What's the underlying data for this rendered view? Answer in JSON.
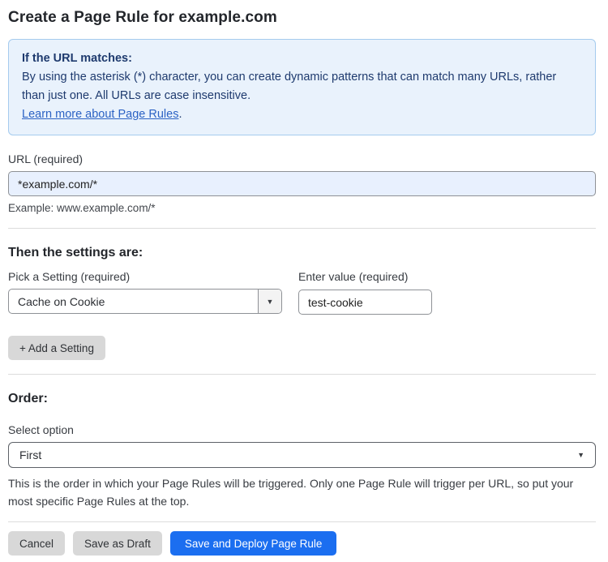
{
  "page": {
    "title": "Create a Page Rule for example.com"
  },
  "info_box": {
    "heading": "If the URL matches:",
    "body": "By using the asterisk (*) character, you can create dynamic patterns that can match many URLs, rather than just one. All URLs are case insensitive.",
    "link": "Learn more about Page Rules",
    "link_suffix": "."
  },
  "url_field": {
    "label": "URL (required)",
    "value": "*example.com/*",
    "example": "Example: www.example.com/*"
  },
  "settings_section": {
    "heading": "Then the settings are:",
    "setting_label": "Pick a Setting (required)",
    "setting_value": "Cache on Cookie",
    "value_label": "Enter value (required)",
    "value_value": "test-cookie",
    "add_button_label": "+ Add a Setting",
    "dropdown_arrow": "▼"
  },
  "order_section": {
    "heading": "Order:",
    "select_label": "Select option",
    "select_value": "First",
    "dropdown_arrow": "▼",
    "help": "This is the order in which your Page Rules will be triggered. Only one Page Rule will trigger per URL, so put your most specific Page Rules at the top."
  },
  "footer": {
    "cancel_label": "Cancel",
    "save_draft_label": "Save as Draft",
    "save_deploy_label": "Save and Deploy Page Rule"
  },
  "colors": {
    "info_box_bg": "#e9f2fc",
    "info_box_border": "#a5cbee",
    "info_text": "#1e3a6e",
    "link_blue": "#2b62c4",
    "url_input_bg": "#e8f0fe",
    "primary_button": "#1b6ef0",
    "gray_button": "#d8d8d8"
  }
}
